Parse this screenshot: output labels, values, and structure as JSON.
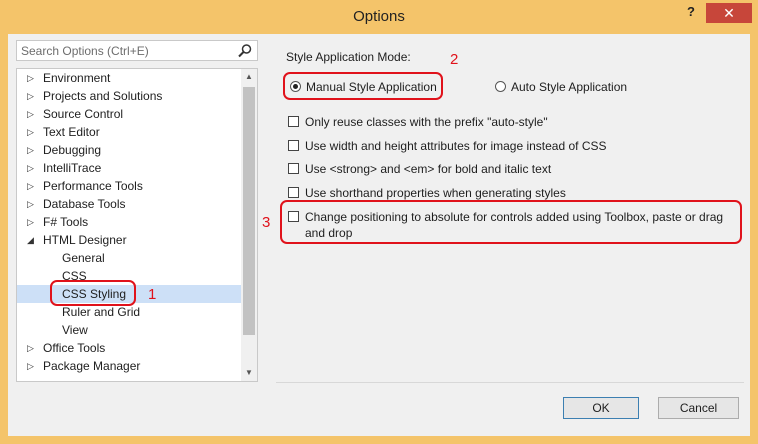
{
  "window": {
    "title": "Options",
    "help_label": "?",
    "close_label": "✕"
  },
  "search": {
    "placeholder": "Search Options (Ctrl+E)"
  },
  "tree": {
    "items": [
      {
        "label": "Environment",
        "arrow": "▷"
      },
      {
        "label": "Projects and Solutions",
        "arrow": "▷"
      },
      {
        "label": "Source Control",
        "arrow": "▷"
      },
      {
        "label": "Text Editor",
        "arrow": "▷"
      },
      {
        "label": "Debugging",
        "arrow": "▷"
      },
      {
        "label": "IntelliTrace",
        "arrow": "▷"
      },
      {
        "label": "Performance Tools",
        "arrow": "▷"
      },
      {
        "label": "Database Tools",
        "arrow": "▷"
      },
      {
        "label": "F# Tools",
        "arrow": "▷"
      },
      {
        "label": "HTML Designer",
        "arrow": "◢"
      },
      {
        "label": "General"
      },
      {
        "label": "CSS"
      },
      {
        "label": "CSS Styling"
      },
      {
        "label": "Ruler and Grid"
      },
      {
        "label": "View"
      },
      {
        "label": "Office Tools",
        "arrow": "▷"
      },
      {
        "label": "Package Manager",
        "arrow": "▷"
      }
    ]
  },
  "style_mode": {
    "label": "Style Application Mode:",
    "manual_label": "Manual Style Application",
    "auto_label": "Auto Style Application"
  },
  "checkboxes": {
    "reuse_classes": "Only reuse classes with the prefix \"auto-style\"",
    "width_height": "Use width and height attributes for image instead of CSS",
    "strong_em": "Use <strong> and <em> for bold and italic text",
    "shorthand": "Use shorthand properties when generating styles",
    "positioning_line1": "Change positioning to absolute for controls added using Toolbox, paste or drag",
    "positioning_line2": "and drop"
  },
  "buttons": {
    "ok_label": "OK",
    "cancel_label": "Cancel"
  },
  "annotations": {
    "one": "1",
    "two": "2",
    "three": "3"
  },
  "colors": {
    "annotation": "#e0121b",
    "title_bar": "#f4c46a",
    "close_button": "#c7463a",
    "selection": "#cde0f7"
  }
}
